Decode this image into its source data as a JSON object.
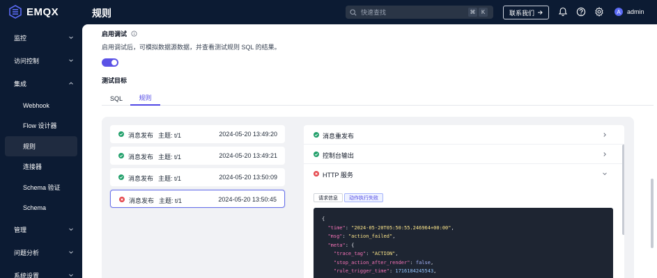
{
  "brand": "EMQX",
  "page_title": "规则",
  "search": {
    "placeholder": "快速查找",
    "shortcut_mod": "⌘",
    "shortcut_key": "K"
  },
  "contact_label": "联系我们",
  "user": {
    "initial": "A",
    "name": "admin"
  },
  "sidebar": {
    "groups": [
      {
        "label": "监控"
      },
      {
        "label": "访问控制"
      },
      {
        "label": "集成"
      },
      {
        "label": "管理"
      },
      {
        "label": "问题分析"
      },
      {
        "label": "系统设置"
      }
    ],
    "integration_items": [
      {
        "label": "Webhook"
      },
      {
        "label": "Flow 设计器"
      },
      {
        "label": "规则",
        "active": true
      },
      {
        "label": "连接器"
      },
      {
        "label": "Schema 验证"
      },
      {
        "label": "Schema"
      }
    ]
  },
  "debug": {
    "label": "启用调试",
    "description": "启用调试后，可模拟数据源数据，并查看测试规则 SQL 的结果。",
    "enabled": true,
    "target_label": "测试目标"
  },
  "tabs": [
    {
      "label": "SQL",
      "active": false
    },
    {
      "label": "规则",
      "active": true
    }
  ],
  "logs": [
    {
      "status": "success",
      "label": "消息发布",
      "topic": "主题: t/1",
      "time": "2024-05-20 13:49:20"
    },
    {
      "status": "success",
      "label": "消息发布",
      "topic": "主题: t/1",
      "time": "2024-05-20 13:49:21"
    },
    {
      "status": "success",
      "label": "消息发布",
      "topic": "主题: t/1",
      "time": "2024-05-20 13:50:09"
    },
    {
      "status": "failed",
      "label": "消息发布",
      "topic": "主题: t/1",
      "time": "2024-05-20 13:50:45",
      "selected": true
    }
  ],
  "actions": [
    {
      "status": "success",
      "name": "消息重发布",
      "expanded": false
    },
    {
      "status": "success",
      "name": "控制台输出",
      "expanded": false
    },
    {
      "status": "failed",
      "name": "HTTP 服务",
      "expanded": true
    }
  ],
  "detail_tabs": [
    {
      "label": "请求信息",
      "active": false
    },
    {
      "label": "动作执行失败",
      "active": true
    }
  ],
  "code": {
    "time": "2024-05-20T05:50:55.246964+00:00",
    "msg": "action_failed",
    "trace_tag": "ACTION",
    "stop_action_after_render": "false",
    "rule_trigger_time": "1716184245543"
  },
  "colors": {
    "sidebar_bg": "#0c1b33",
    "accent": "#4f46e5",
    "success": "#22a06b",
    "error": "#e5484d"
  }
}
